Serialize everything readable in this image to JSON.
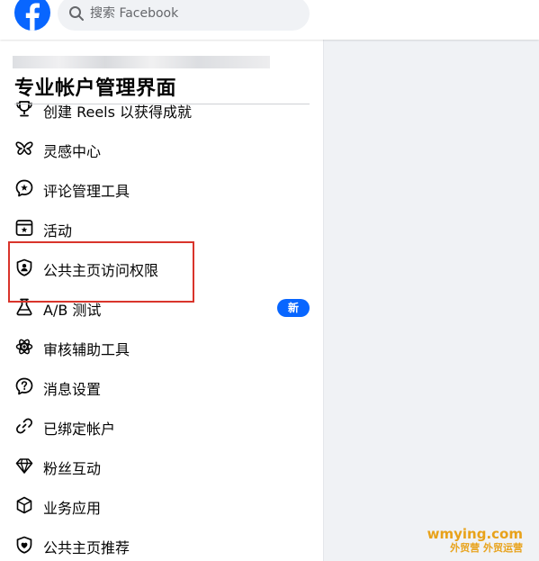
{
  "search": {
    "placeholder": "搜索 Facebook"
  },
  "panel": {
    "title": "专业帐户管理界面"
  },
  "menu": {
    "items": [
      {
        "label": "创建 Reels 以获得成就",
        "icon": "trophy-icon"
      },
      {
        "label": "灵感中心",
        "icon": "butterfly-icon"
      },
      {
        "label": "评论管理工具",
        "icon": "comment-star-icon"
      },
      {
        "label": "活动",
        "icon": "calendar-star-icon"
      },
      {
        "label": "公共主页访问权限",
        "icon": "shield-person-icon"
      },
      {
        "label": "A/B 测试",
        "icon": "flask-icon",
        "badge": "新"
      },
      {
        "label": "审核辅助工具",
        "icon": "atom-icon"
      },
      {
        "label": "消息设置",
        "icon": "question-bubble-icon"
      },
      {
        "label": "已绑定帐户",
        "icon": "link-icon"
      },
      {
        "label": "粉丝互动",
        "icon": "diamond-icon"
      },
      {
        "label": "业务应用",
        "icon": "cube-icon"
      },
      {
        "label": "公共主页推荐",
        "icon": "shield-heart-icon"
      }
    ]
  },
  "watermark": {
    "line1": "wmying.com",
    "line2": "外贸营 外贸运营"
  },
  "colors": {
    "brand": "#0866ff",
    "highlight": "#d9342b",
    "watermark": "#e8a21a"
  }
}
